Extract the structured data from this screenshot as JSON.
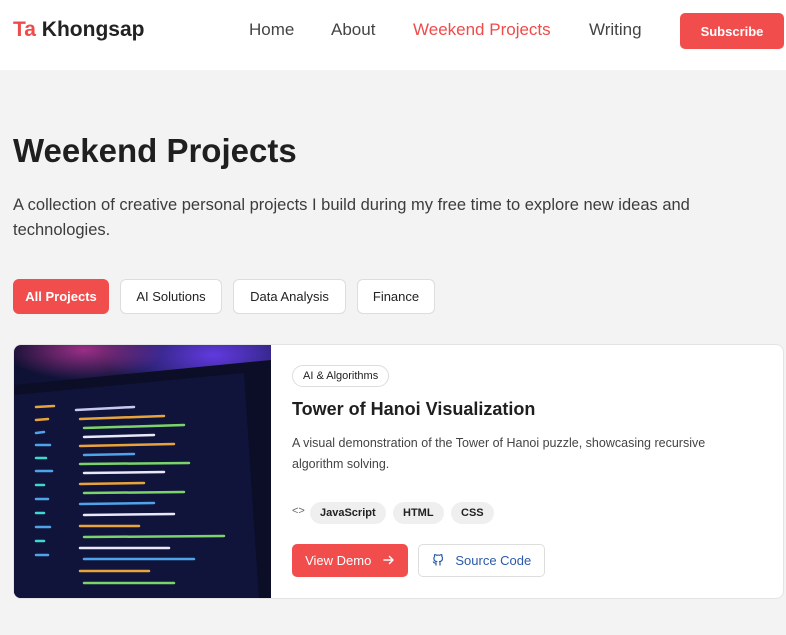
{
  "header": {
    "logo_accent": "Ta",
    "logo_text": "Khongsap",
    "nav": [
      {
        "label": "Home"
      },
      {
        "label": "About"
      },
      {
        "label": "Weekend Projects"
      },
      {
        "label": "Writing"
      }
    ],
    "subscribe_label": "Subscribe",
    "accent_color": "#f24d4d"
  },
  "main": {
    "title": "Weekend Projects",
    "intro": "A collection of creative personal projects I build during my free time to explore new ideas and technologies.",
    "filters": [
      {
        "label": "All Projects",
        "active": true
      },
      {
        "label": "AI Solutions",
        "active": false
      },
      {
        "label": "Data Analysis",
        "active": false
      },
      {
        "label": "Finance",
        "active": false
      }
    ]
  },
  "project": {
    "category": "AI & Algorithms",
    "title": "Tower of Hanoi Visualization",
    "description": "A visual demonstration of the Tower of Hanoi puzzle, showcasing recursive algorithm solving.",
    "tech_icon": "code-icon",
    "tags": [
      "JavaScript",
      "HTML",
      "CSS"
    ],
    "demo_label": "View Demo",
    "demo_icon": "arrow-right-icon",
    "source_label": "Source Code",
    "source_icon": "github-icon"
  }
}
